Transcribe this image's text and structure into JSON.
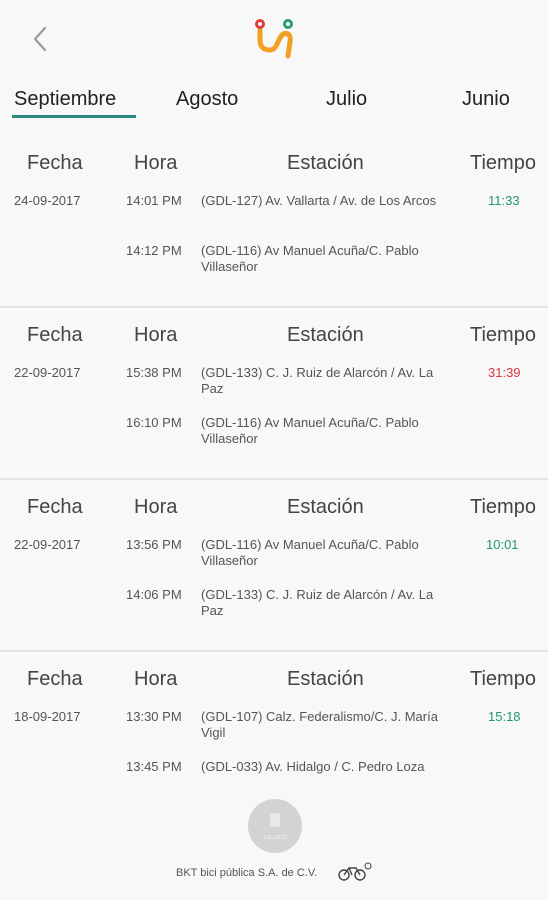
{
  "nav": {
    "back": "‹"
  },
  "tabs": [
    {
      "label": "Septiembre",
      "active": true
    },
    {
      "label": "Agosto",
      "active": false
    },
    {
      "label": "Julio",
      "active": false
    },
    {
      "label": "Junio",
      "active": false
    }
  ],
  "columns": {
    "fecha": "Fecha",
    "hora": "Hora",
    "estacion": "Estación",
    "tiempo": "Tiempo"
  },
  "trips": [
    {
      "fecha": "24-09-2017",
      "tiempo": "11:33",
      "tiempo_status": "ok",
      "legs": [
        {
          "hora": "14:01 PM",
          "estacion": "(GDL-127) Av. Vallarta / Av. de Los Arcos"
        },
        {
          "hora": "14:12 PM",
          "estacion": "(GDL-116) Av Manuel Acuña/C. Pablo Villaseñor"
        }
      ]
    },
    {
      "fecha": "22-09-2017",
      "tiempo": "31:39",
      "tiempo_status": "over",
      "legs": [
        {
          "hora": "15:38 PM",
          "estacion": "(GDL-133) C. J. Ruiz de Alarcón / Av. La Paz"
        },
        {
          "hora": "16:10 PM",
          "estacion": "(GDL-116) Av Manuel Acuña/C. Pablo Villaseñor"
        }
      ]
    },
    {
      "fecha": "22-09-2017",
      "tiempo": "10:01",
      "tiempo_status": "ok",
      "legs": [
        {
          "hora": "13:56 PM",
          "estacion": "(GDL-116) Av Manuel Acuña/C. Pablo Villaseñor"
        },
        {
          "hora": "14:06 PM",
          "estacion": "(GDL-133) C. J. Ruiz de Alarcón / Av. La Paz"
        }
      ]
    },
    {
      "fecha": "18-09-2017",
      "tiempo": "15:18",
      "tiempo_status": "ok",
      "legs": [
        {
          "hora": "13:30 PM",
          "estacion": "(GDL-107) Calz. Federalismo/C. J. María Vigil"
        },
        {
          "hora": "13:45 PM",
          "estacion": "(GDL-033) Av. Hidalgo / C. Pedro Loza"
        }
      ]
    }
  ],
  "footer": {
    "company": "BKT bici pública S.A. de C.V.",
    "seal_text": "JALISCO"
  },
  "colors": {
    "accent": "#2b8a7e",
    "ok": "#1f9a6a",
    "over": "#d9363e",
    "logo_orange": "#f2a023",
    "logo_red": "#e23b3b",
    "logo_green": "#2b9a6e"
  },
  "icons": {
    "back": "chevron-left-icon",
    "logo": "mibici-logo-icon",
    "bike": "bicycle-icon"
  }
}
